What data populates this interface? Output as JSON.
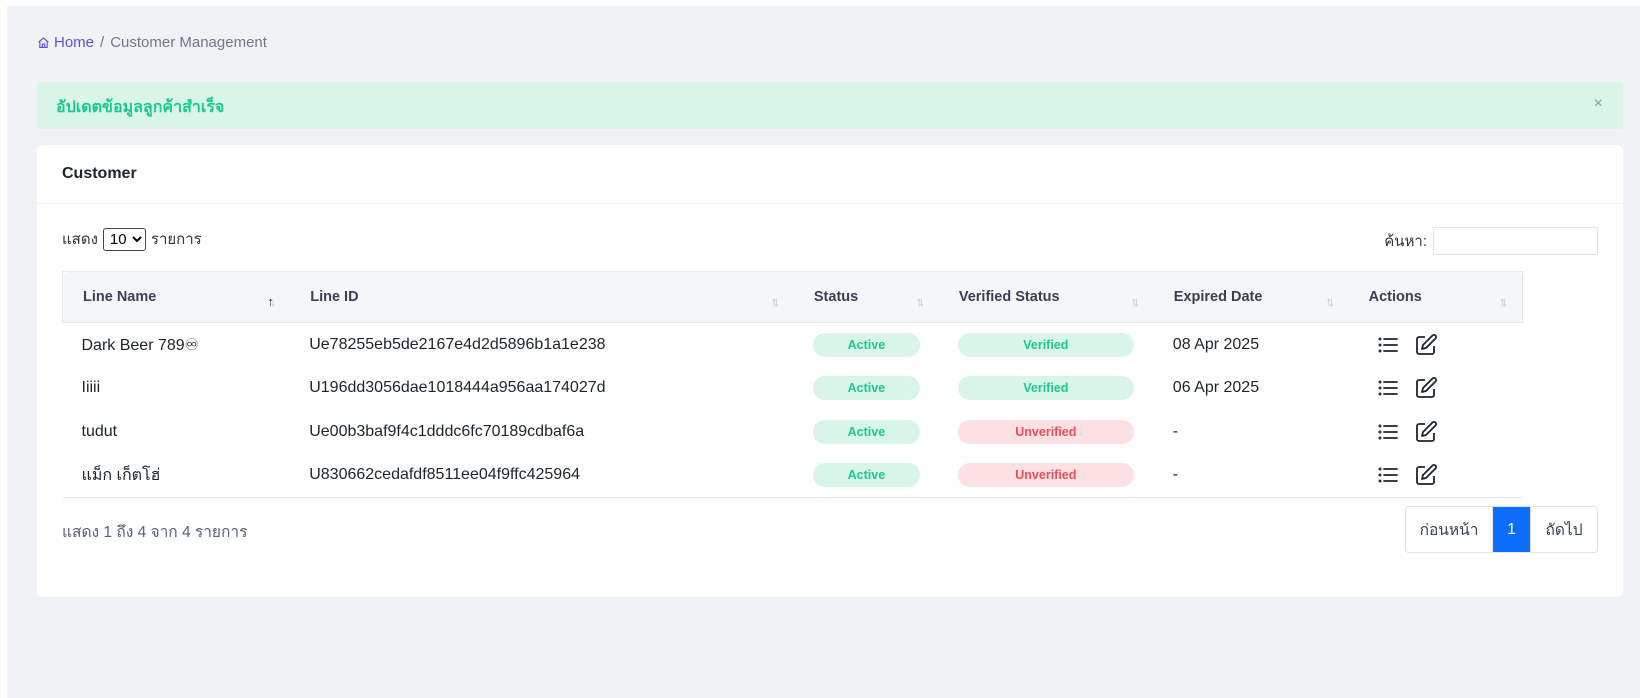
{
  "breadcrumb": {
    "home": "Home",
    "separator": "/",
    "current": "Customer Management",
    "home_icon": "home-icon"
  },
  "alert": {
    "message": "อัปเดตข้อมูลลูกค้าสำเร็จ",
    "close": "×"
  },
  "card": {
    "title": "Customer"
  },
  "controls": {
    "show_prefix": "แสดง",
    "page_size": "10",
    "page_size_options": [
      "10"
    ],
    "show_suffix": "รายการ",
    "search_label": "ค้นหา:",
    "search_value": ""
  },
  "table": {
    "columns": [
      "Line Name",
      "Line ID",
      "Status",
      "Verified Status",
      "Expired Date",
      "Actions"
    ],
    "rows": [
      {
        "name": "Dark Beer 789♾",
        "line_id": "Ue78255eb5de2167e4d2d5896b1a1e238",
        "status": "Active",
        "verified": "Verified",
        "expired": "08 Apr 2025"
      },
      {
        "name": "Iiiii",
        "line_id": "U196dd3056dae1018444a956aa174027d",
        "status": "Active",
        "verified": "Verified",
        "expired": "06 Apr 2025"
      },
      {
        "name": "tudut",
        "line_id": "Ue00b3baf9f4c1dddc6fc70189cdbaf6a",
        "status": "Active",
        "verified": "Unverified",
        "expired": "-"
      },
      {
        "name": "แม็ก เก็ตโฮ่",
        "line_id": "U830662cedafdf8511ee04f9ffc425964",
        "status": "Active",
        "verified": "Unverified",
        "expired": "-"
      }
    ],
    "action_icons": [
      "list-icon",
      "edit-icon"
    ]
  },
  "footer": {
    "info": "แสดง 1 ถึง 4 จาก 4 รายการ",
    "prev": "ก่อนหน้า",
    "current_page": "1",
    "next": "ถัดไป"
  },
  "colors": {
    "accent": "#0d6efd",
    "success": "#1ec98f",
    "danger": "#ef4d5b",
    "link": "#5a55d8"
  }
}
